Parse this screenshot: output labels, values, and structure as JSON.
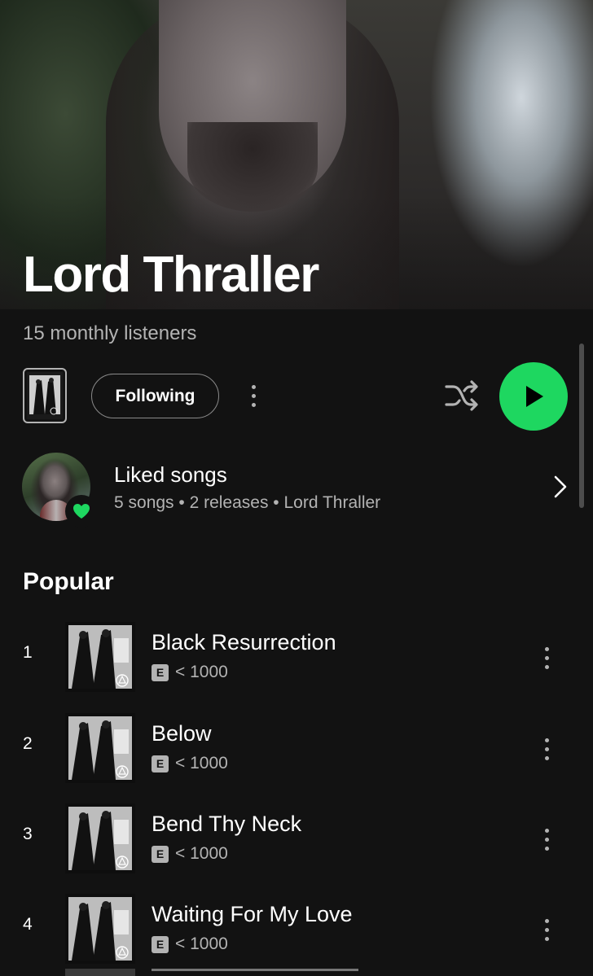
{
  "artist": {
    "name": "Lord Thraller",
    "monthly_listeners": "15 monthly listeners"
  },
  "controls": {
    "follow_label": "Following",
    "accent_color": "#1ed760"
  },
  "liked": {
    "title": "Liked songs",
    "subtitle": "5 songs • 2 releases • Lord Thraller"
  },
  "popular": {
    "title": "Popular",
    "tracks": [
      {
        "num": "1",
        "title": "Black Resurrection",
        "explicit": "E",
        "plays": "< 1000"
      },
      {
        "num": "2",
        "title": "Below",
        "explicit": "E",
        "plays": "< 1000"
      },
      {
        "num": "3",
        "title": "Bend Thy Neck",
        "explicit": "E",
        "plays": "< 1000"
      },
      {
        "num": "4",
        "title": "Waiting For My Love",
        "explicit": "E",
        "plays": "< 1000"
      }
    ]
  },
  "icons": {
    "more": "more-vertical-icon",
    "shuffle": "shuffle-icon",
    "play": "play-icon",
    "chevron": "chevron-right-icon",
    "heart": "heart-icon"
  }
}
